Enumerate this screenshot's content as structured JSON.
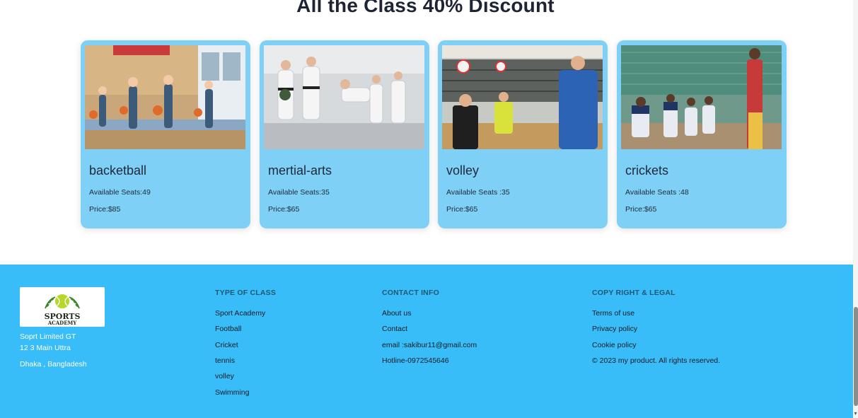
{
  "heading": "All the Class 40% Discount",
  "cards": [
    {
      "title": "basketball_display",
      "name": "backetball",
      "seats": "Available Seats:49",
      "price": "Price:$85"
    },
    {
      "name": "mertial-arts",
      "seats": "Available Seats:35",
      "price": "Price:$65"
    },
    {
      "name": "volley",
      "seats": "Available Seats :35",
      "price": "Price:$65"
    },
    {
      "name": "crickets",
      "seats": "Available Seats :48",
      "price": "Price:$65"
    }
  ],
  "footer": {
    "logo_text": {
      "line1": "SPORTS",
      "line2": "ACADEMY"
    },
    "address": [
      "Soprt Limited GT",
      "12 3 Main Uttra",
      "Dhaka , Bangladesh"
    ],
    "type_of_class": {
      "title": "TYPE OF CLASS",
      "items": [
        "Sport Academy",
        "Football",
        "Cricket",
        "tennis",
        "volley",
        "Swimming"
      ]
    },
    "contact_info": {
      "title": "CONTACT INFO",
      "items": [
        "About us",
        "Contact",
        "email :sakibur11@gmail.com",
        "Hotline-0972545646"
      ]
    },
    "legal": {
      "title": "COPY RIGHT & LEGAL",
      "items": [
        "Terms of use",
        "Privacy policy",
        "Cookie policy",
        "© 2023 my product. All rights reserved."
      ]
    }
  },
  "colors": {
    "card_bg": "#7fd0f7",
    "footer_bg": "#38bdf8",
    "title_text": "#1d2433"
  }
}
